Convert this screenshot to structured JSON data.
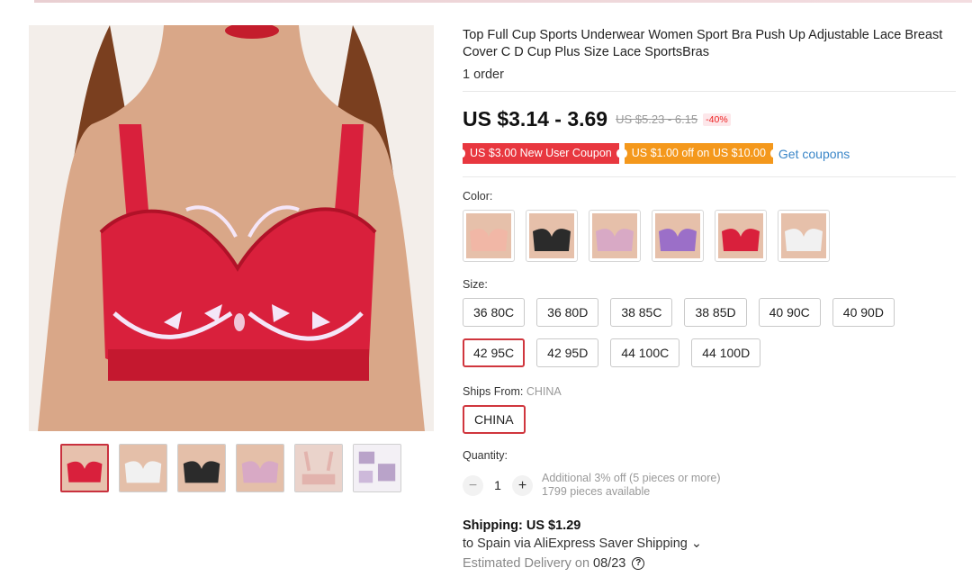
{
  "product": {
    "title": "Top Full Cup Sports Underwear Women Sport Bra Push Up Adjustable Lace Breast Cover C D Cup Plus Size Lace SportsBras",
    "orders": "1 order",
    "price": "US $3.14 - 3.69",
    "old_price": "US $5.23 - 6.15",
    "discount": "-40%"
  },
  "coupons": {
    "new_user": "US $3.00 New User Coupon",
    "off": "US $1.00 off on US $10.00",
    "get": "Get coupons"
  },
  "color": {
    "label": "Color:",
    "options": [
      "nude",
      "black",
      "pink",
      "purple",
      "red",
      "white"
    ],
    "swatch_colors": [
      "#f1b7a6",
      "#2b2b2b",
      "#d8a9c5",
      "#9b6fc8",
      "#d9203c",
      "#f1f1f1"
    ]
  },
  "size": {
    "label": "Size:",
    "options": [
      "36 80C",
      "36 80D",
      "38 85C",
      "38 85D",
      "40 90C",
      "40 90D",
      "42 95C",
      "42 95D",
      "44 100C",
      "44 100D"
    ],
    "selected": "42 95C"
  },
  "ships_from": {
    "label": "Ships From:",
    "value": "CHINA",
    "option": "CHINA"
  },
  "quantity": {
    "label": "Quantity:",
    "minus": "−",
    "value": "1",
    "plus": "+",
    "note1": "Additional 3% off (5 pieces or more)",
    "note2": "1799 pieces available"
  },
  "shipping": {
    "title": "Shipping: US $1.29",
    "method": "to Spain via AliExpress Saver Shipping ⌄",
    "estimated": "Estimated Delivery on",
    "date": "08/23",
    "help": "?"
  },
  "gallery": {
    "main_color": "#d9203c",
    "thumb_colors": [
      "#d9203c",
      "#f1f1f1",
      "#2b2b2b",
      "#d8a9c5",
      "#e2b3ad",
      "#b9a3c9"
    ]
  }
}
